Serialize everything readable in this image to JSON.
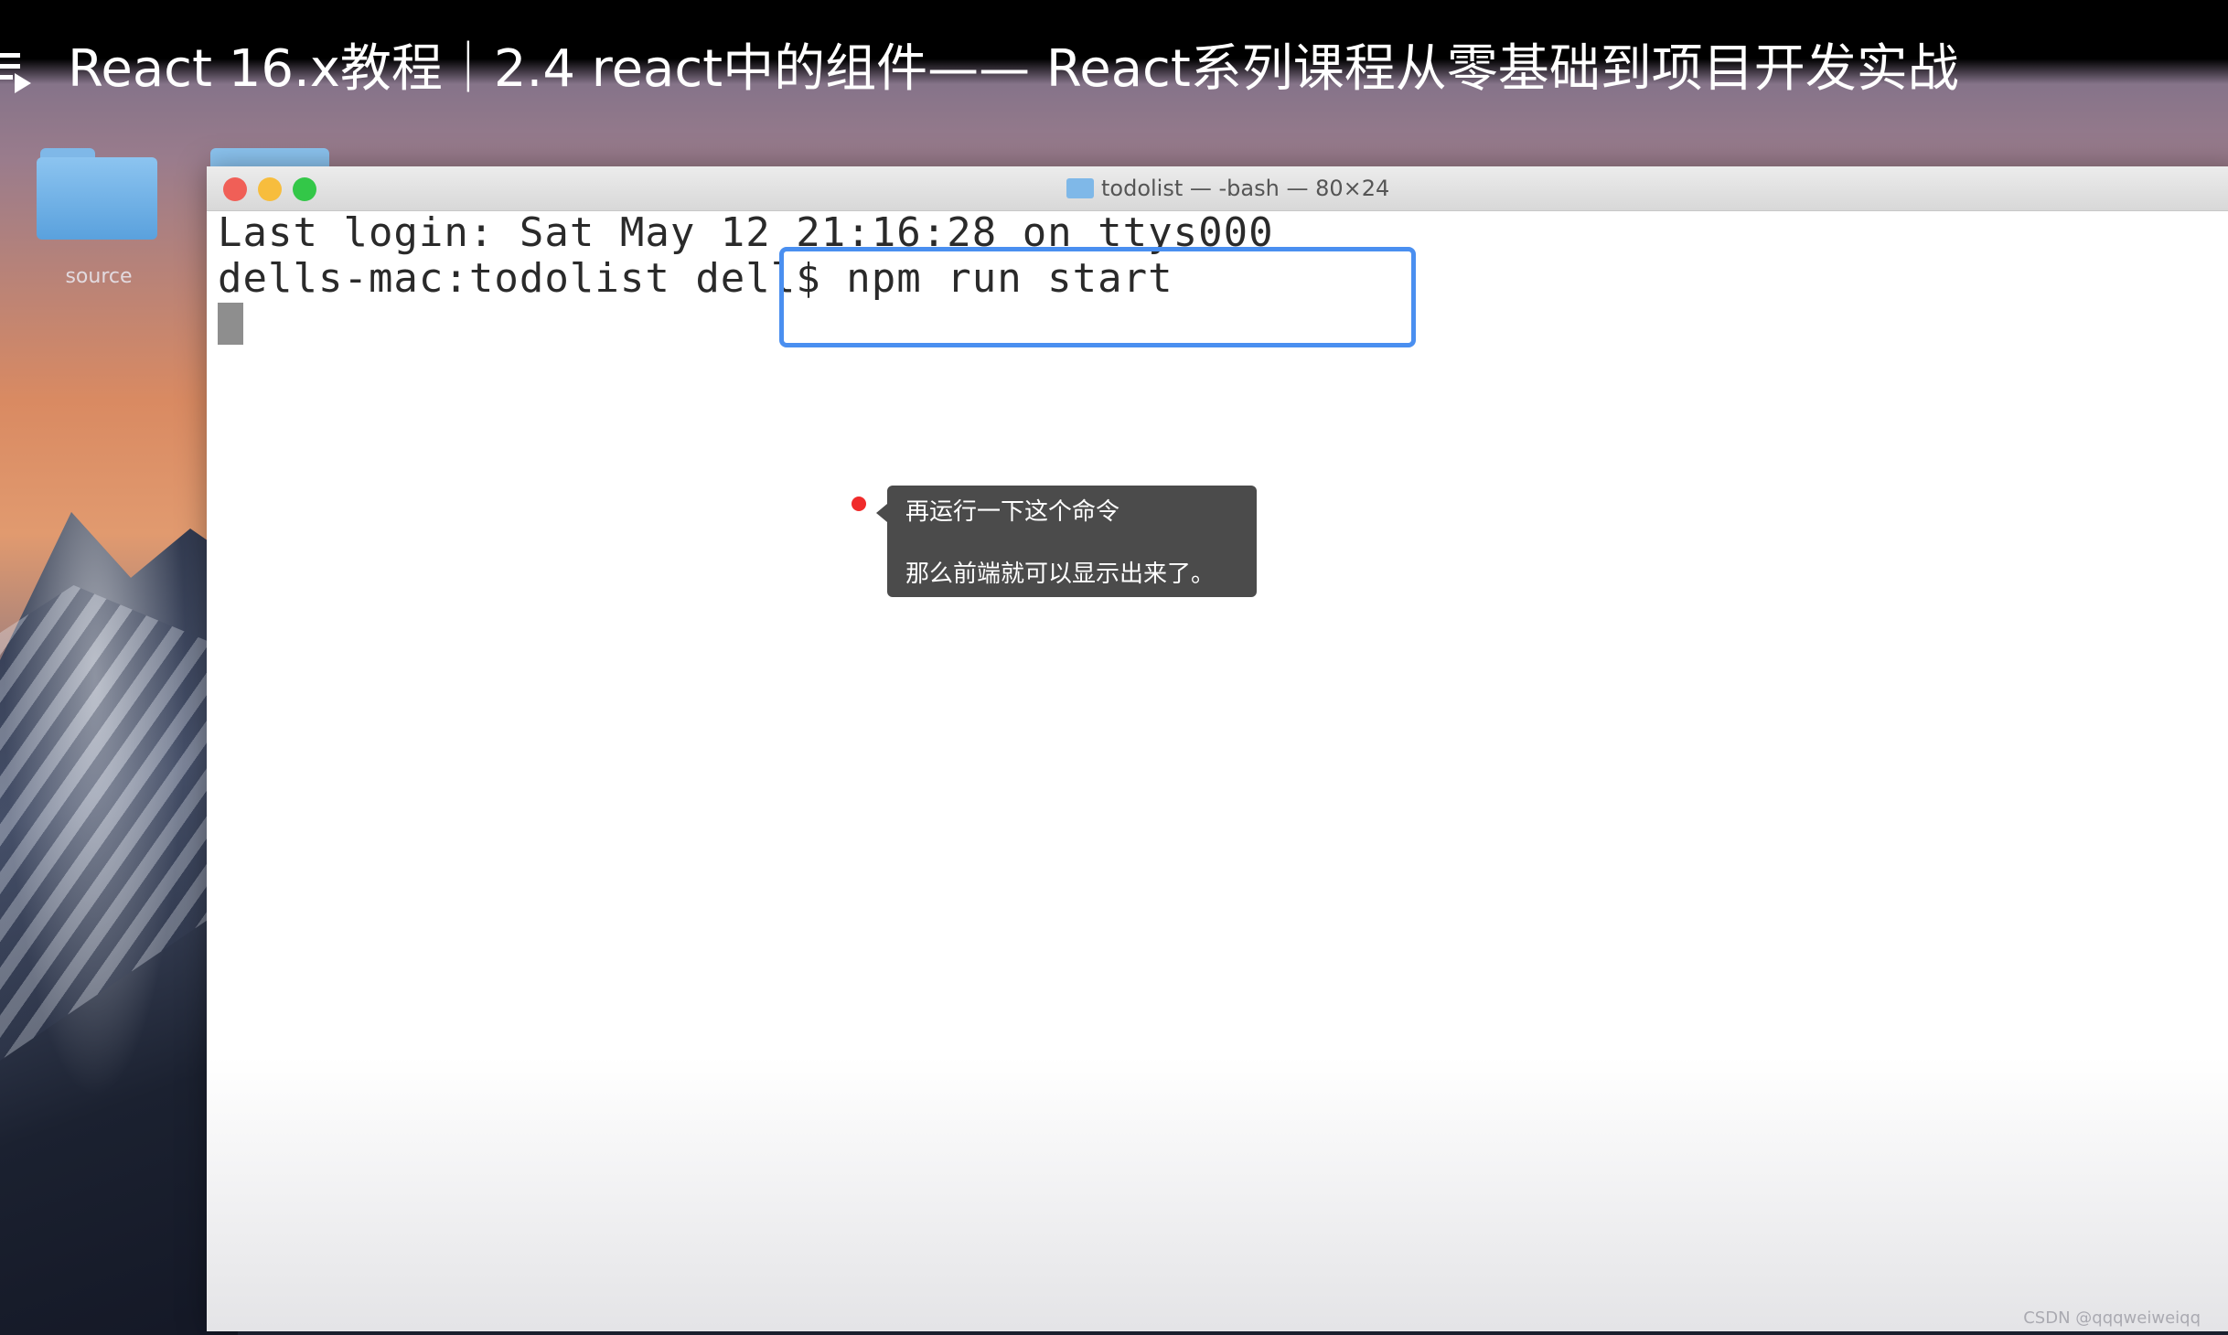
{
  "video": {
    "title": "React 16.x教程｜2.4 react中的组件—— React系列课程从零基础到项目开发实战"
  },
  "desktop": {
    "folder_label": "source"
  },
  "terminal": {
    "window_title": "todolist — -bash — 80×24",
    "lines": [
      "Last login: Sat May 12 21:16:28 on ttys000",
      "dells-mac:todolist dell$ npm run start"
    ]
  },
  "annotation": {
    "line1": "再运行一下这个命令",
    "line2": "那么前端就可以显示出来了。"
  },
  "watermark": "CSDN @qqqweiweiqq",
  "colors": {
    "highlight": "#4a8ff0",
    "annotation_dot": "#f02b2b",
    "tooltip_bg": "#4b4b4b"
  }
}
